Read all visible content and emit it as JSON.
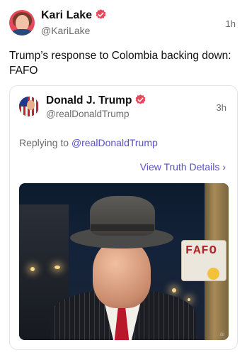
{
  "post": {
    "author_name": "Kari Lake",
    "handle": "@KariLake",
    "time": "1h",
    "text": "Trump’s response to Colombia backing down: FAFO"
  },
  "quote": {
    "author_name": "Donald J. Trump",
    "handle": "@realDonaldTrump",
    "time": "3h",
    "replying_prefix": "Replying to",
    "replying_mention": "@realDonaldTrump",
    "details_link": "View Truth Details",
    "image": {
      "sign_text": "FAFO",
      "watermark": "ai"
    }
  },
  "icons": {
    "verified": "verified-badge-icon",
    "chevron": "chevron-right-icon"
  },
  "colors": {
    "verified": "#e8485c",
    "link": "#5a4fcf",
    "secondary_text": "#6b6b6b"
  }
}
